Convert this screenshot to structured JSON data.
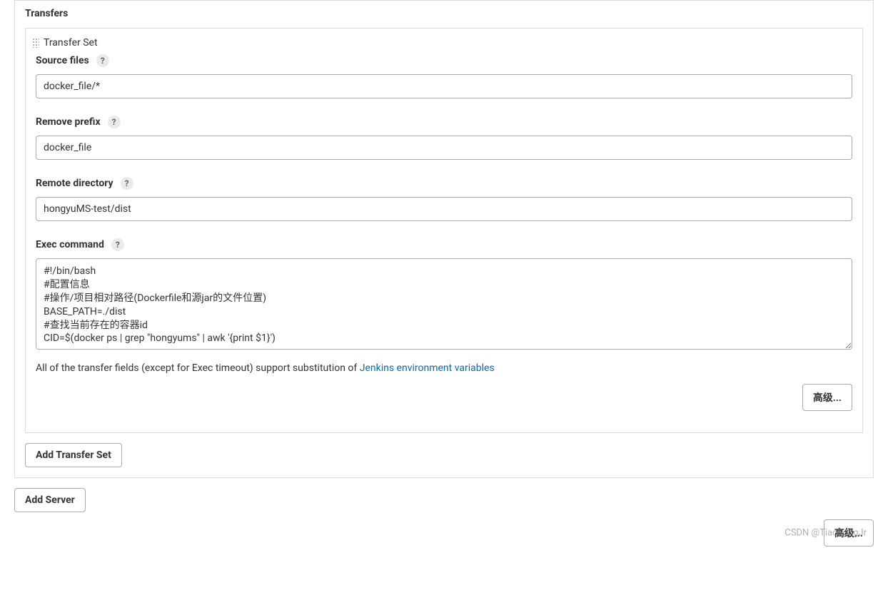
{
  "transfers": {
    "title": "Transfers",
    "transfer_set_label": "Transfer Set",
    "fields": {
      "source_files": {
        "label": "Source files",
        "value": "docker_file/*"
      },
      "remove_prefix": {
        "label": "Remove prefix",
        "value": "docker_file"
      },
      "remote_directory": {
        "label": "Remote directory",
        "value": "hongyuMS-test/dist"
      },
      "exec_command": {
        "label": "Exec command",
        "value": "#!/bin/bash\n#配置信息\n#操作/项目相对路径(Dockerfile和源jar的文件位置)\nBASE_PATH=./dist\n#查找当前存在的容器id\nCID=$(docker ps | grep \"hongyums\" | awk '{print $1}')"
      }
    },
    "help_icon": "?",
    "help_text_prefix": "All of the transfer fields (except for Exec timeout) support substitution of ",
    "help_link_text": "Jenkins environment variables",
    "advanced_button": "高级...",
    "add_transfer_set_button": "Add Transfer Set"
  },
  "add_server_button": "Add Server",
  "bottom_advanced_button": "高级...",
  "watermark": "CSDN @TiaoLongJr"
}
